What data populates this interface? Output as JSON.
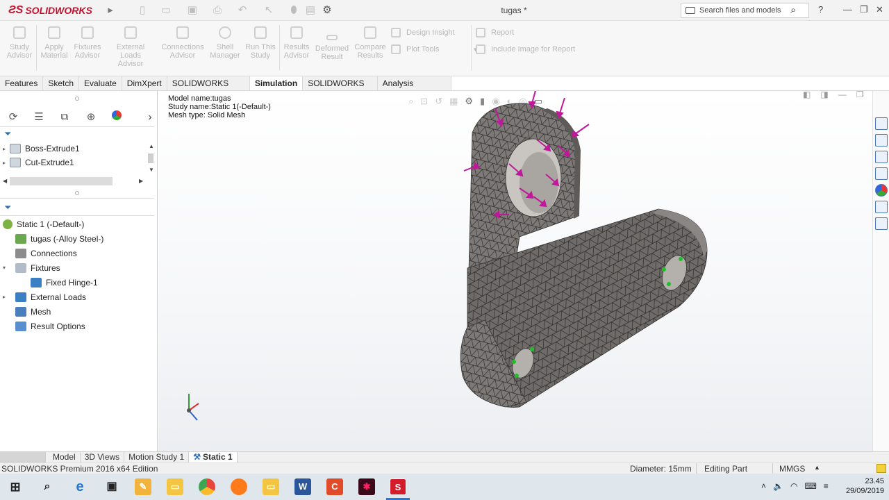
{
  "app": {
    "logo": "SOLIDWORKS",
    "document_title": "tugas *",
    "search_placeholder": "Search files and models",
    "help": "?"
  },
  "commands": {
    "study_advisor": [
      "Study",
      "Advisor"
    ],
    "apply_material": [
      "Apply",
      "Material"
    ],
    "fixtures_advisor": [
      "Fixtures",
      "Advisor"
    ],
    "external_loads_advisor": [
      "External Loads",
      "Advisor"
    ],
    "connections_advisor": [
      "Connections",
      "Advisor"
    ],
    "shell_manager": [
      "Shell",
      "Manager"
    ],
    "run_this_study": [
      "Run This",
      "Study"
    ],
    "results_advisor": [
      "Results",
      "Advisor"
    ],
    "deformed_result": [
      "Deformed",
      "Result"
    ],
    "compare_results": [
      "Compare",
      "Results"
    ],
    "design_insight": "Design Insight",
    "plot_tools": "Plot Tools",
    "report": "Report",
    "include_image": "Include Image for Report"
  },
  "tabs": [
    "Features",
    "Sketch",
    "Evaluate",
    "DimXpert",
    "SOLIDWORKS Add-Ins",
    "Simulation",
    "SOLIDWORKS MBD",
    "Analysis Preparation"
  ],
  "active_tab": "Simulation",
  "feature_tree": {
    "items": [
      "Boss-Extrude1",
      "Cut-Extrude1"
    ]
  },
  "study_tree": {
    "root": "Static 1 (-Default-)",
    "part": "tugas (-Alloy Steel-)",
    "connections": "Connections",
    "fixtures": "Fixtures",
    "fixed_hinge": "Fixed Hinge-1",
    "external_loads": "External Loads",
    "mesh": "Mesh",
    "result_options": "Result Options"
  },
  "viewport": {
    "model_name": "Model name:tugas",
    "study_name": "Study name:Static 1(-Default-)",
    "mesh_type": "Mesh type: Solid Mesh"
  },
  "bottom_tabs": [
    "Model",
    "3D Views",
    "Motion Study 1",
    "Static 1"
  ],
  "status": {
    "edition": "SOLIDWORKS Premium 2016 x64 Edition",
    "diameter": "Diameter: 15mm",
    "editing": "Editing Part",
    "units": "MMGS"
  },
  "clock": {
    "time": "23.45",
    "date": "29/09/2019"
  },
  "colors": {
    "accent_red": "#c8102e",
    "mesh_fill": "#6f6b68",
    "load_arrow": "#c0189a",
    "fixture_marker": "#1fbf2a"
  }
}
